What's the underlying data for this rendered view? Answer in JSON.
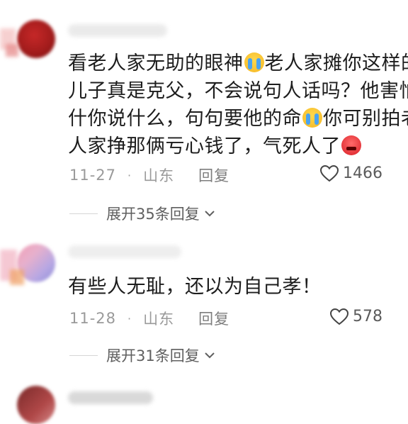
{
  "comments": [
    {
      "text_lines": [
        [
          "看老人家无助的眼神",
          {
            "emoji": "cry"
          },
          "老人家摊你这样的"
        ],
        [
          "儿子真是克父，不会说句人话吗？他害怕"
        ],
        [
          "什你说什么，句句要他的命",
          {
            "emoji": "cry"
          },
          "你可别拍老"
        ],
        [
          "人家挣那俩亏心钱了，气死人了",
          {
            "emoji": "angry"
          }
        ]
      ],
      "date": "11-27",
      "dot": "·",
      "location": "山东",
      "reply_label": "回复",
      "likes": "1466",
      "expand_label": "展开35条回复"
    },
    {
      "text_lines": [
        [
          "有些人无耻，还以为自己孝！"
        ]
      ],
      "date": "11-28",
      "dot": "·",
      "location": "山东",
      "reply_label": "回复",
      "likes": "578",
      "expand_label": "展开31条回复"
    }
  ],
  "icons": {
    "heart": "heart-icon",
    "chevron": "chevron-down-icon",
    "emoji_cry": "crying-face-emoji",
    "emoji_angry": "angry-face-emoji"
  },
  "colors": {
    "text": "#1d1d1d",
    "meta": "#9a9a9a",
    "like": "#5a5a5a"
  }
}
